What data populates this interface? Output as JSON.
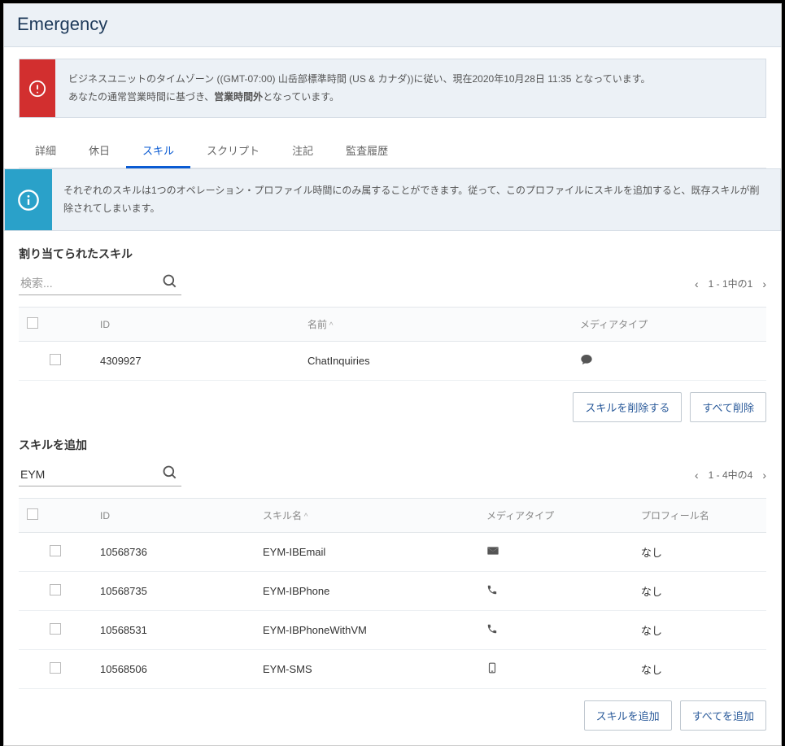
{
  "header": {
    "title": "Emergency"
  },
  "alert": {
    "line1_a": "ビジネスユニットのタイムゾーン ((GMT-07:00) 山岳部標準時間 (US & カナダ))に従い、現在2020年10月28日 11:35 となっています。",
    "line2_a": "あなたの通常営業時間に基づき、",
    "line2_bold": "営業時間外",
    "line2_b": "となっています。"
  },
  "tabs": {
    "items": [
      {
        "label": "詳細",
        "active": false
      },
      {
        "label": "休日",
        "active": false
      },
      {
        "label": "スキル",
        "active": true
      },
      {
        "label": "スクリプト",
        "active": false
      },
      {
        "label": "注記",
        "active": false
      },
      {
        "label": "監査履歴",
        "active": false
      }
    ]
  },
  "info": {
    "text": "それぞれのスキルは1つのオペレーション・プロファイル時間にのみ属することができます。従って、このプロファイルにスキルを追加すると、既存スキルが削除されてしまいます。"
  },
  "assigned": {
    "title": "割り当てられたスキル",
    "search_placeholder": "検索...",
    "search_value": "",
    "pager": "1 - 1中の1",
    "columns": {
      "id": "ID",
      "name": "名前",
      "media": "メディアタイプ"
    },
    "rows": [
      {
        "id": "4309927",
        "name": "ChatInquiries",
        "media": "chat"
      }
    ],
    "btn_remove": "スキルを削除する",
    "btn_remove_all": "すべて削除"
  },
  "add": {
    "title": "スキルを追加",
    "search_value": "EYM",
    "pager": "1 - 4中の4",
    "columns": {
      "id": "ID",
      "skill": "スキル名",
      "media": "メディアタイプ",
      "profile": "プロフィール名"
    },
    "rows": [
      {
        "id": "10568736",
        "name": "EYM-IBEmail",
        "media": "email",
        "profile": "なし"
      },
      {
        "id": "10568735",
        "name": "EYM-IBPhone",
        "media": "phone",
        "profile": "なし"
      },
      {
        "id": "10568531",
        "name": "EYM-IBPhoneWithVM",
        "media": "phone",
        "profile": "なし"
      },
      {
        "id": "10568506",
        "name": "EYM-SMS",
        "media": "sms",
        "profile": "なし"
      }
    ],
    "btn_add": "スキルを追加",
    "btn_add_all": "すべてを追加"
  }
}
